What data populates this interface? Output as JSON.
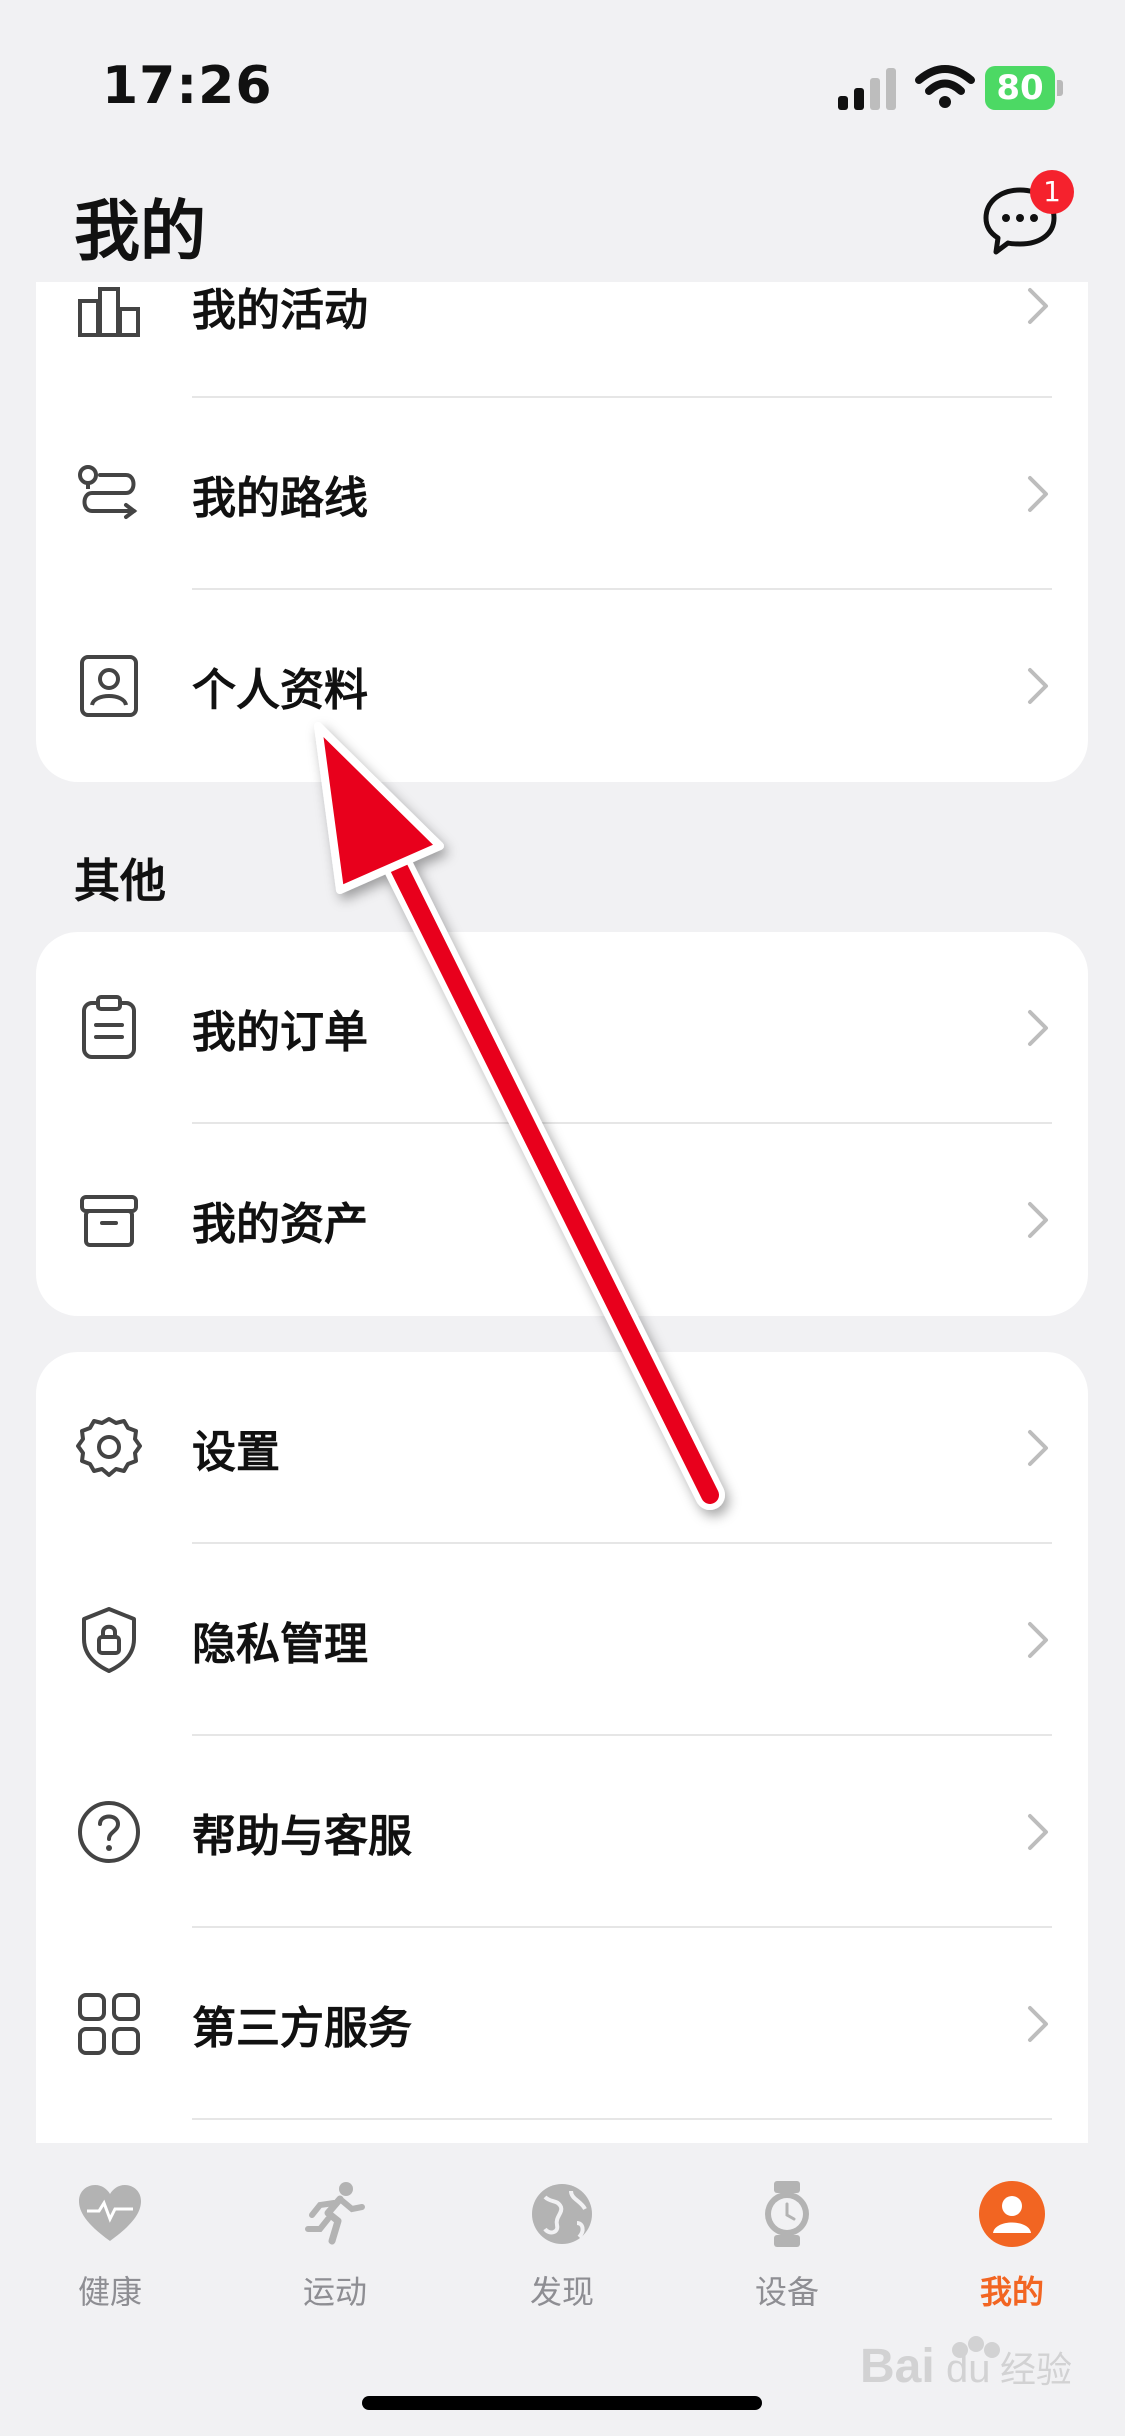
{
  "status": {
    "time": "17:26",
    "battery": "80"
  },
  "header": {
    "title": "我的",
    "message_badge": "1"
  },
  "card1": {
    "items": [
      {
        "label": "我的活动",
        "icon": "activity-icon"
      },
      {
        "label": "我的路线",
        "icon": "route-icon"
      },
      {
        "label": "个人资料",
        "icon": "profile-icon"
      }
    ]
  },
  "section_other": {
    "title": "其他"
  },
  "card2": {
    "items": [
      {
        "label": "我的订单",
        "icon": "orders-icon"
      },
      {
        "label": "我的资产",
        "icon": "assets-icon"
      }
    ]
  },
  "card3": {
    "items": [
      {
        "label": "设置",
        "icon": "gear-icon"
      },
      {
        "label": "隐私管理",
        "icon": "privacy-shield-icon"
      },
      {
        "label": "帮助与客服",
        "icon": "help-icon"
      },
      {
        "label": "第三方服务",
        "icon": "grid-icon"
      }
    ]
  },
  "tabbar": {
    "tabs": [
      {
        "label": "健康",
        "icon": "heart-icon",
        "active": false
      },
      {
        "label": "运动",
        "icon": "running-icon",
        "active": false
      },
      {
        "label": "发现",
        "icon": "globe-icon",
        "active": false
      },
      {
        "label": "设备",
        "icon": "watch-icon",
        "active": false
      },
      {
        "label": "我的",
        "icon": "user-icon",
        "active": true
      }
    ]
  },
  "colors": {
    "accent": "#f26522",
    "annotation_arrow": "#e8001c",
    "badge": "#f5222d"
  },
  "watermark": {
    "text": "Baidu经验"
  }
}
